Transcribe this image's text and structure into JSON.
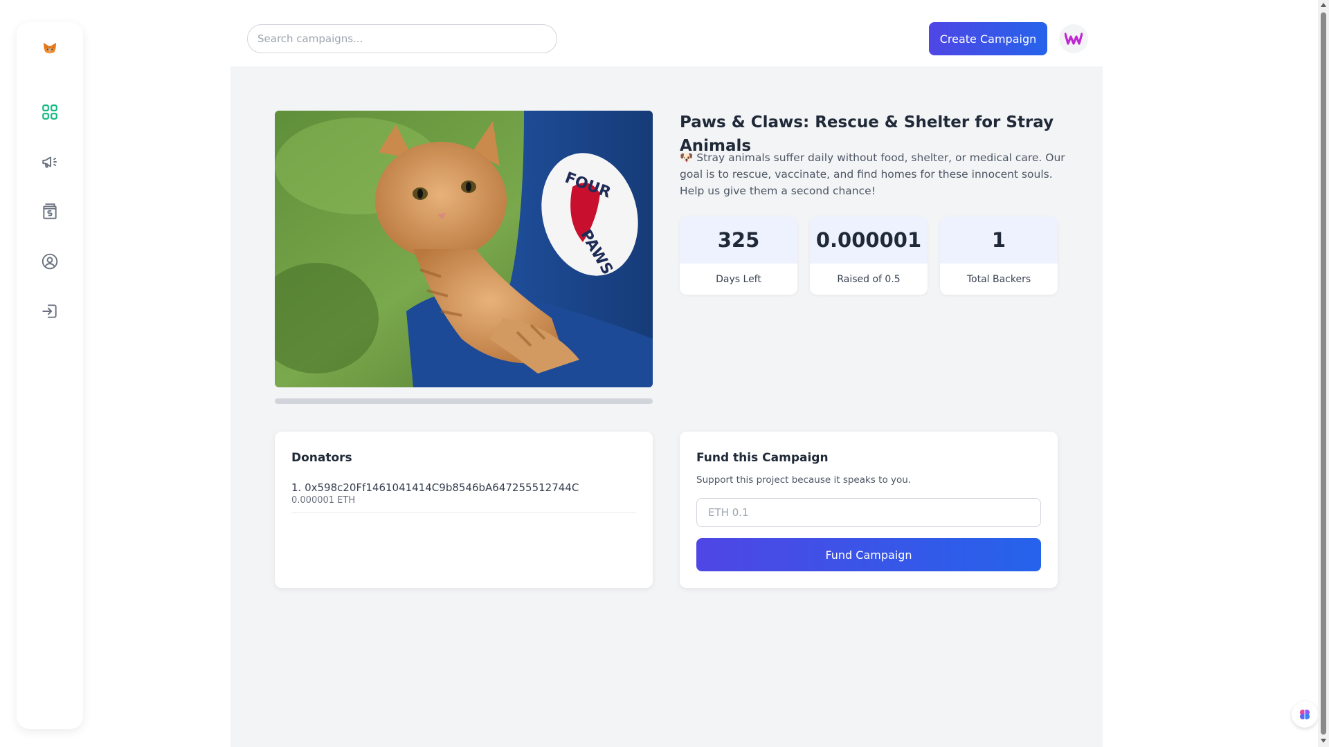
{
  "sidebar": {
    "logo_icon": "metamask-fox-icon",
    "items": [
      {
        "icon": "dashboard-grid-icon",
        "active": true
      },
      {
        "icon": "megaphone-campaign-icon",
        "active": false
      },
      {
        "icon": "payment-dollar-icon",
        "active": false
      },
      {
        "icon": "profile-user-icon",
        "active": false
      },
      {
        "icon": "logout-icon",
        "active": false
      }
    ],
    "active_color": "#10b981",
    "icon_color": "#6b7280"
  },
  "header": {
    "search_placeholder": "Search campaigns...",
    "create_button_label": "Create Campaign",
    "avatar_icon": "user-logo-icon"
  },
  "campaign": {
    "title": "Paws & Claws: Rescue & Shelter for Stray Animals",
    "description": "🐶 Stray animals suffer daily without food, shelter, or medical care. Our goal is to rescue, vaccinate, and find homes for these innocent souls. Help us give them a second chance!",
    "image_alt": "orange tabby kitten held in a blue sleeve with a Four Paws patch",
    "progress_percent": 0.0002
  },
  "stats": [
    {
      "value": "325",
      "label": "Days Left"
    },
    {
      "value": "0.000001",
      "label": "Raised of 0.5"
    },
    {
      "value": "1",
      "label": "Total Backers"
    }
  ],
  "donators": {
    "title": "Donators",
    "items": [
      {
        "address": "1. 0x598c20Ff1461041414C9b8546bA647255512744C",
        "amount": "0.000001 ETH"
      }
    ]
  },
  "fund": {
    "title": "Fund this Campaign",
    "subtitle": "Support this project because it speaks to you.",
    "input_placeholder": "ETH 0.1",
    "button_label": "Fund Campaign"
  },
  "colors": {
    "accent_start": "#4f46e5",
    "accent_end": "#2563eb",
    "background": "#f3f4f6"
  }
}
